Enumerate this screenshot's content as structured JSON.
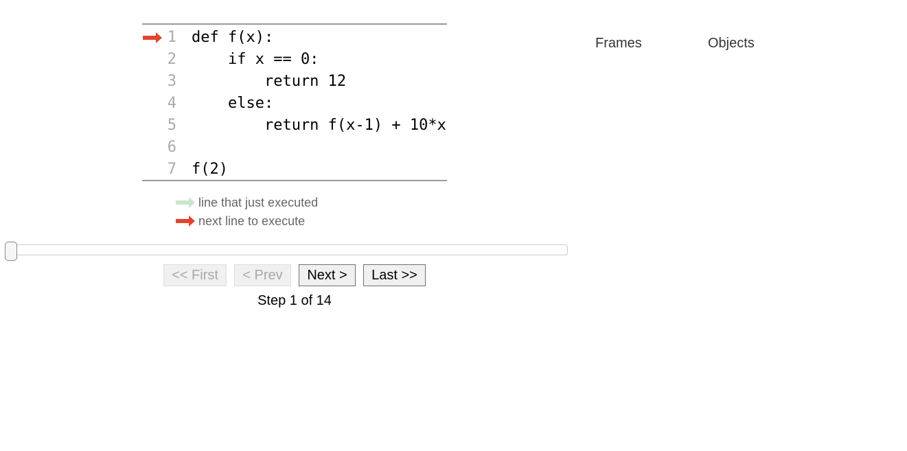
{
  "code": {
    "lines": [
      {
        "number": "1",
        "text": "def f(x):"
      },
      {
        "number": "2",
        "text": "    if x == 0:"
      },
      {
        "number": "3",
        "text": "        return 12"
      },
      {
        "number": "4",
        "text": "    else:"
      },
      {
        "number": "5",
        "text": "        return f(x-1) + 10*x"
      },
      {
        "number": "6",
        "text": ""
      },
      {
        "number": "7",
        "text": "f(2)"
      }
    ],
    "next_line": 1
  },
  "legend": {
    "just_executed": "line that just executed",
    "next_to_execute": "next line to execute"
  },
  "colors": {
    "next_arrow": "#e2442f",
    "executed_arrow": "#c9e6c9"
  },
  "navigation": {
    "first": "<< First",
    "prev": "< Prev",
    "next": "Next >",
    "last": "Last >>",
    "step_text": "Step 1 of 14",
    "current_step": 1,
    "total_steps": 14
  },
  "visualization": {
    "frames_label": "Frames",
    "objects_label": "Objects"
  }
}
